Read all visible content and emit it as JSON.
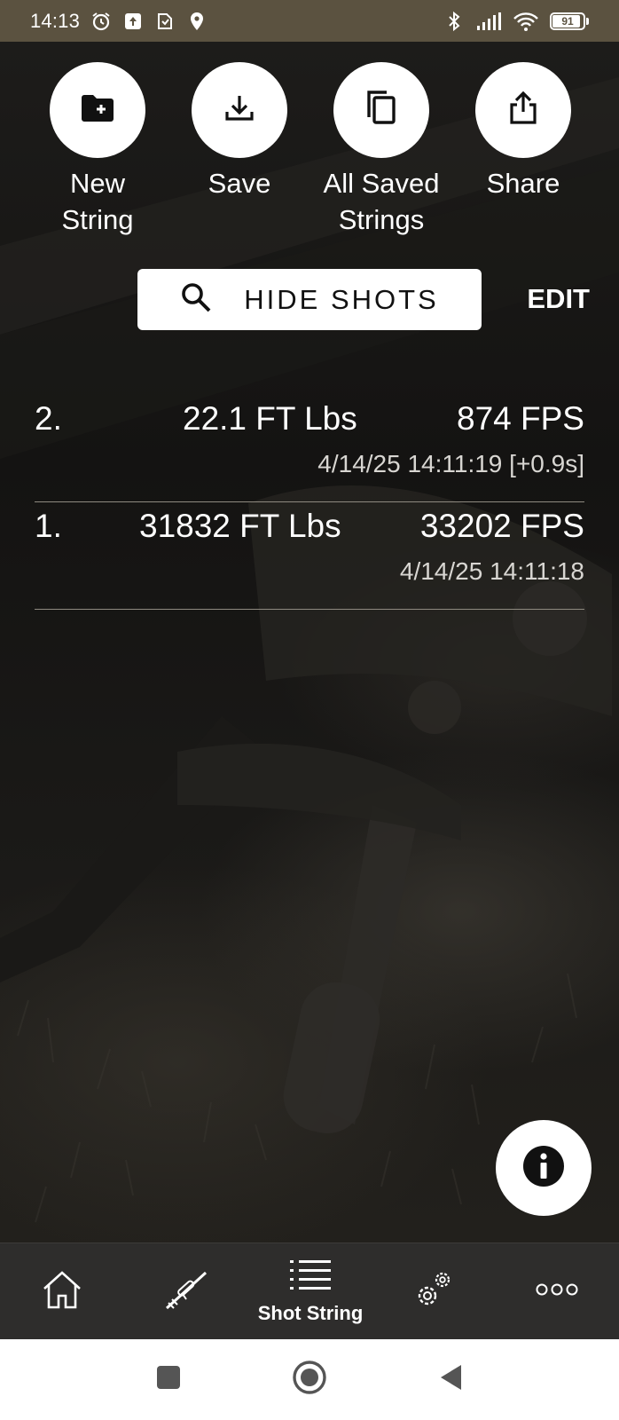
{
  "status_bar": {
    "time": "14:13",
    "battery": "91",
    "left_icons": [
      "alarm-icon",
      "upload-notification-icon",
      "app-notification-icon",
      "location-icon"
    ],
    "right_icons": [
      "bluetooth-icon",
      "signal-icon",
      "wifi-icon",
      "battery-icon"
    ]
  },
  "actions": [
    {
      "name": "new-string-button",
      "icon": "folder-add-icon",
      "label": "New\nString"
    },
    {
      "name": "save-button",
      "icon": "download-icon",
      "label": "Save"
    },
    {
      "name": "all-saved-strings-button",
      "icon": "copy-icon",
      "label": "All Saved\nStrings"
    },
    {
      "name": "share-button",
      "icon": "share-icon",
      "label": "Share"
    }
  ],
  "toolbar": {
    "hide_shots_label": "HIDE SHOTS",
    "edit_label": "EDIT"
  },
  "shots": [
    {
      "number": "2.",
      "energy": "22.1 FT Lbs",
      "velocity": "874 FPS",
      "timestamp": "4/14/25 14:11:19 [+0.9s]"
    },
    {
      "number": "1.",
      "energy": "31832 FT Lbs",
      "velocity": "33202 FPS",
      "timestamp": "4/14/25 14:11:18"
    }
  ],
  "fab": {
    "icon": "info-icon"
  },
  "bottom_nav": {
    "items": [
      {
        "name": "nav-home",
        "icon": "home-icon",
        "label": ""
      },
      {
        "name": "nav-rifle",
        "icon": "rifle-icon",
        "label": ""
      },
      {
        "name": "nav-shot-string",
        "icon": "list-icon",
        "label": "Shot String"
      },
      {
        "name": "nav-settings",
        "icon": "gear-icon",
        "label": ""
      },
      {
        "name": "nav-more",
        "icon": "more-icon",
        "label": ""
      }
    ],
    "active": "Shot String"
  },
  "system_nav": [
    "recents-square-icon",
    "home-circle-icon",
    "back-triangle-icon"
  ],
  "colors": {
    "status_bar": "#5b5240",
    "background": "#141312",
    "nav_bar": "#2e2d2c",
    "button_bg": "#ffffff"
  }
}
